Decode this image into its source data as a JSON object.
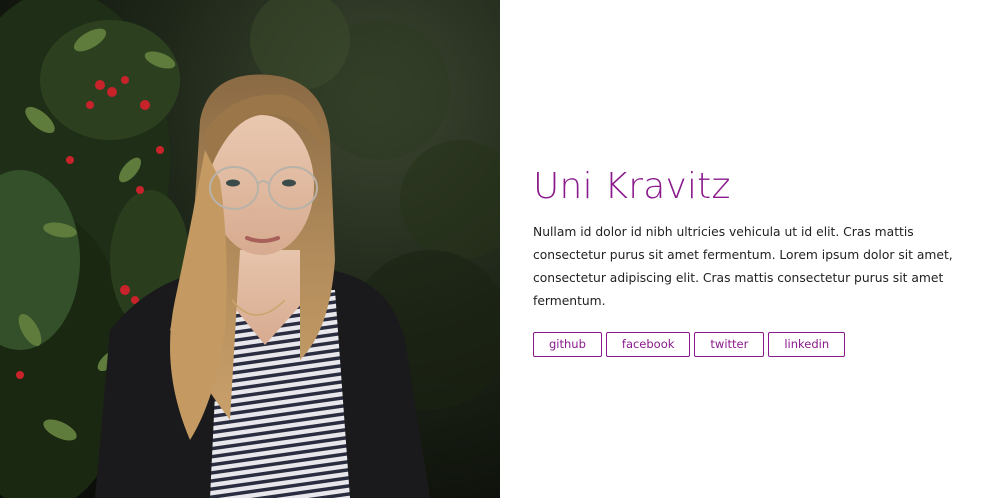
{
  "colors": {
    "accent": "#8a1a8c"
  },
  "photo": {
    "icon": "portrait-photo"
  },
  "profile": {
    "name": "Uni Kravitz",
    "bio": "Nullam id dolor id nibh ultricies vehicula ut id elit. Cras mattis consectetur purus sit amet fermentum. Lorem ipsum dolor sit amet, consectetur adipiscing elit. Cras mattis consectetur purus sit amet fermentum."
  },
  "socials": [
    {
      "label": "github"
    },
    {
      "label": "facebook"
    },
    {
      "label": "twitter"
    },
    {
      "label": "linkedin"
    }
  ]
}
